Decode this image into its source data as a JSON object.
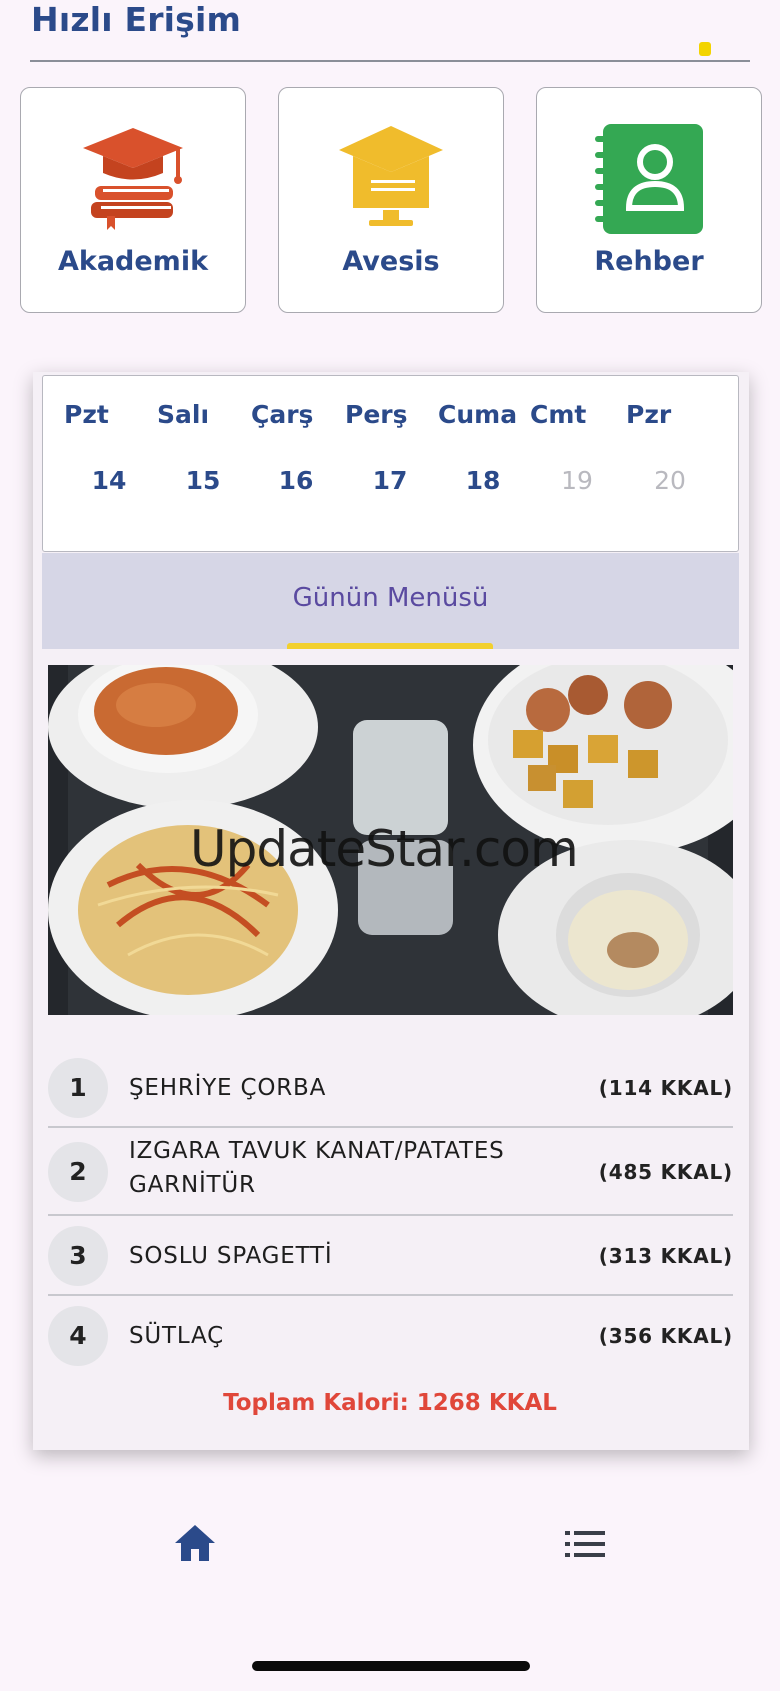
{
  "quick_access": {
    "title": "Hızlı Erişim",
    "cards": [
      {
        "label": "Akademik",
        "icon": "graduation-cap-books-icon"
      },
      {
        "label": "Avesis",
        "icon": "graduation-cap-monitor-icon"
      },
      {
        "label": "Rehber",
        "icon": "address-book-icon"
      }
    ]
  },
  "week": {
    "days": [
      {
        "name": "Pzt",
        "num": "14",
        "active": true
      },
      {
        "name": "Salı",
        "num": "15",
        "active": true
      },
      {
        "name": "Çarş",
        "num": "16",
        "active": true
      },
      {
        "name": "Perş",
        "num": "17",
        "active": true
      },
      {
        "name": "Cuma",
        "num": "18",
        "active": true
      },
      {
        "name": "Cmt",
        "num": "19",
        "active": false
      },
      {
        "name": "Pzr",
        "num": "20",
        "active": false
      }
    ]
  },
  "tab": {
    "label": "Günün Menüsü"
  },
  "watermark": "UpdateStar.com",
  "menu": {
    "items": [
      {
        "num": "1",
        "name": "ŞEHRİYE ÇORBA",
        "kcal": "(114 KKAL)"
      },
      {
        "num": "2",
        "name_line1": "IZGARA TAVUK KANAT/PATATES",
        "name_line2": "GARNİTÜR",
        "kcal": "(485 KKAL)"
      },
      {
        "num": "3",
        "name": "SOSLU SPAGETTİ",
        "kcal": "(313 KKAL)"
      },
      {
        "num": "4",
        "name": "SÜTLAÇ",
        "kcal": "(356 KKAL)"
      }
    ],
    "total": "Toplam Kalori: 1268 KKAL"
  },
  "nav": {
    "home_icon": "home-icon",
    "list_icon": "list-icon"
  },
  "colors": {
    "primary": "#2b4a8a",
    "accent": "#f2d02e",
    "total": "#e0473a",
    "tab_text": "#5a4aa0"
  }
}
